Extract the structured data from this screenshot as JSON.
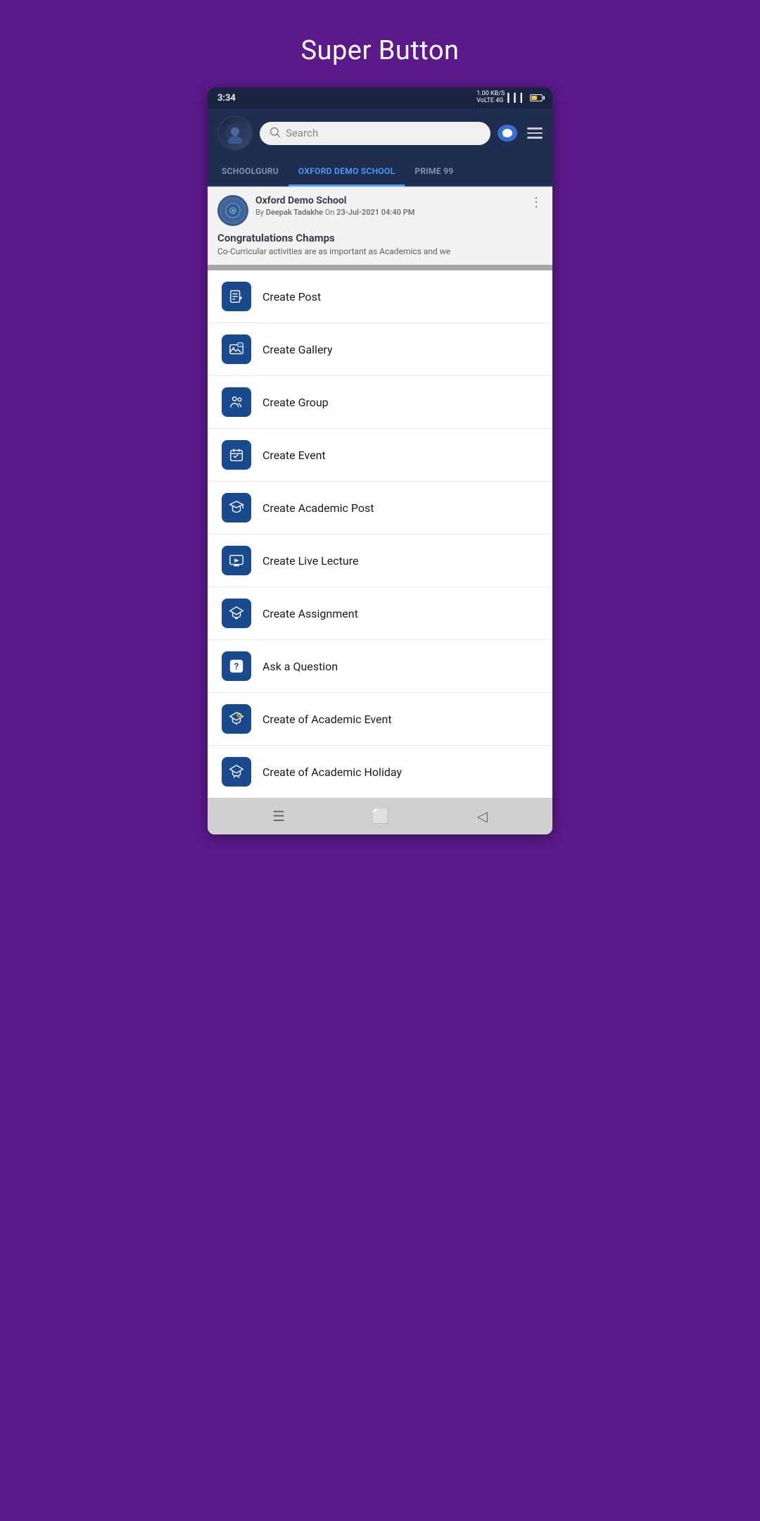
{
  "page": {
    "title": "Super Button"
  },
  "statusBar": {
    "time": "3:34",
    "speed": "1.00 KB/S",
    "network": "VoLTE 4G"
  },
  "header": {
    "searchPlaceholder": "Search",
    "avatarAlt": "user avatar"
  },
  "tabs": [
    {
      "id": "schoolguru",
      "label": "SCHOOLGURU",
      "active": false
    },
    {
      "id": "oxford",
      "label": "OXFORD DEMO SCHOOL",
      "active": true
    },
    {
      "id": "prime99",
      "label": "PRIME 99",
      "active": false
    }
  ],
  "post": {
    "schoolName": "Oxford Demo School",
    "meta": "By Deepak Tadakhe On 23-Jul-2021 04:40 PM",
    "title": "Congratulations Champs",
    "excerpt": "Co-Curricular activities are as important as Academics and we"
  },
  "menuItems": [
    {
      "id": "create-post",
      "label": "Create Post",
      "icon": "📝"
    },
    {
      "id": "create-gallery",
      "label": "Create Gallery",
      "icon": "🖼"
    },
    {
      "id": "create-group",
      "label": "Create Group",
      "icon": "👥"
    },
    {
      "id": "create-event",
      "label": "Create Event",
      "icon": "📅"
    },
    {
      "id": "create-academic-post",
      "label": "Create Academic Post",
      "icon": "🎓"
    },
    {
      "id": "create-live-lecture",
      "label": "Create Live Lecture",
      "icon": "🖥"
    },
    {
      "id": "create-assignment",
      "label": "Create Assignment",
      "icon": "📚"
    },
    {
      "id": "ask-question",
      "label": "Ask a Question",
      "icon": "❓"
    },
    {
      "id": "create-academic-event",
      "label": "Create of Academic Event",
      "icon": "🎓"
    },
    {
      "id": "create-academic-holiday",
      "label": "Create of Academic Holiday",
      "icon": "🏖"
    }
  ],
  "bottomNav": {
    "menu": "☰",
    "home": "⬜",
    "back": "◁"
  }
}
